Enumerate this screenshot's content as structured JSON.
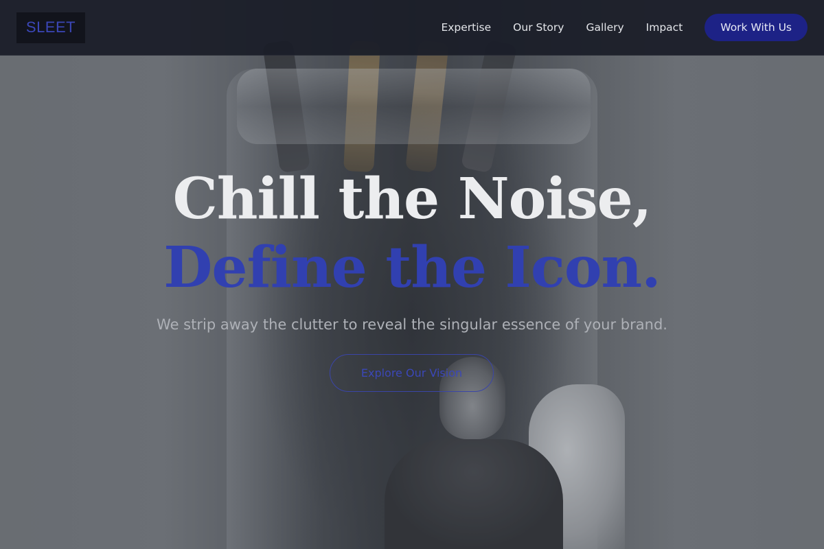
{
  "navbar": {
    "logo": "SLEET",
    "links": [
      "Expertise",
      "Our Story",
      "Gallery",
      "Impact"
    ],
    "cta_label": "Work With Us"
  },
  "hero": {
    "headline_line1": "Chill the Noise,",
    "headline_line2": "Define the Icon.",
    "subtitle": "We strip away the clutter to reveal the singular essence of your brand.",
    "button_label": "Explore Our Vision"
  },
  "colors": {
    "accent": "#3140b0",
    "cta_background": "#1d2286",
    "navbar_background": "#1b1e28",
    "headline_light": "#ecedef",
    "subtitle": "#aeb1b7"
  },
  "icons": []
}
